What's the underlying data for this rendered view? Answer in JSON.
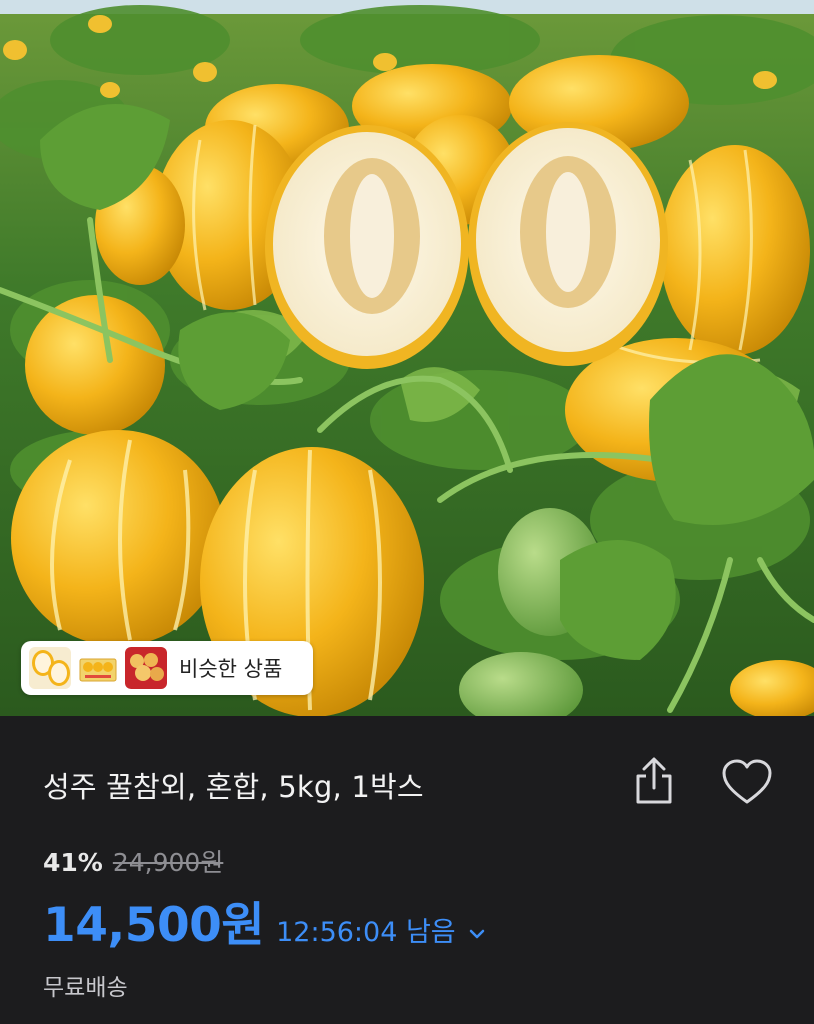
{
  "product": {
    "title": "성주 꿀참외, 혼합, 5kg, 1박스",
    "discount": "41%",
    "original_price": "24,900원",
    "price": "14,500원",
    "timer": "12:56:04 남음",
    "shipping": "무료배송"
  },
  "similar": {
    "label": "비슷한 상품"
  },
  "colors": {
    "background": "#1c1c1e",
    "price_accent": "#3d8ef7",
    "melon_yellow": "#f4b41a"
  },
  "icons": {
    "share": "share-icon",
    "like": "heart-icon",
    "timer_toggle": "chevron-down-icon"
  }
}
